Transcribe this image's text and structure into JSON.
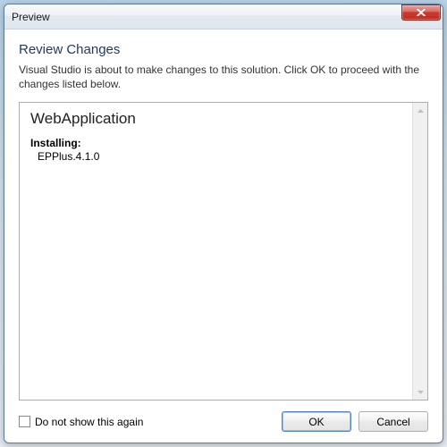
{
  "window": {
    "title": "Preview"
  },
  "dialog": {
    "heading": "Review Changes",
    "description": "Visual Studio is about to make changes to this solution. Click OK to proceed with the changes listed below."
  },
  "changes": {
    "project_name": "WebApplication",
    "installing_label": "Installing:",
    "packages": [
      "EPPlus.4.1.0"
    ]
  },
  "footer": {
    "dont_show_label": "Do not show this again",
    "dont_show_checked": false,
    "ok_label": "OK",
    "cancel_label": "Cancel"
  }
}
